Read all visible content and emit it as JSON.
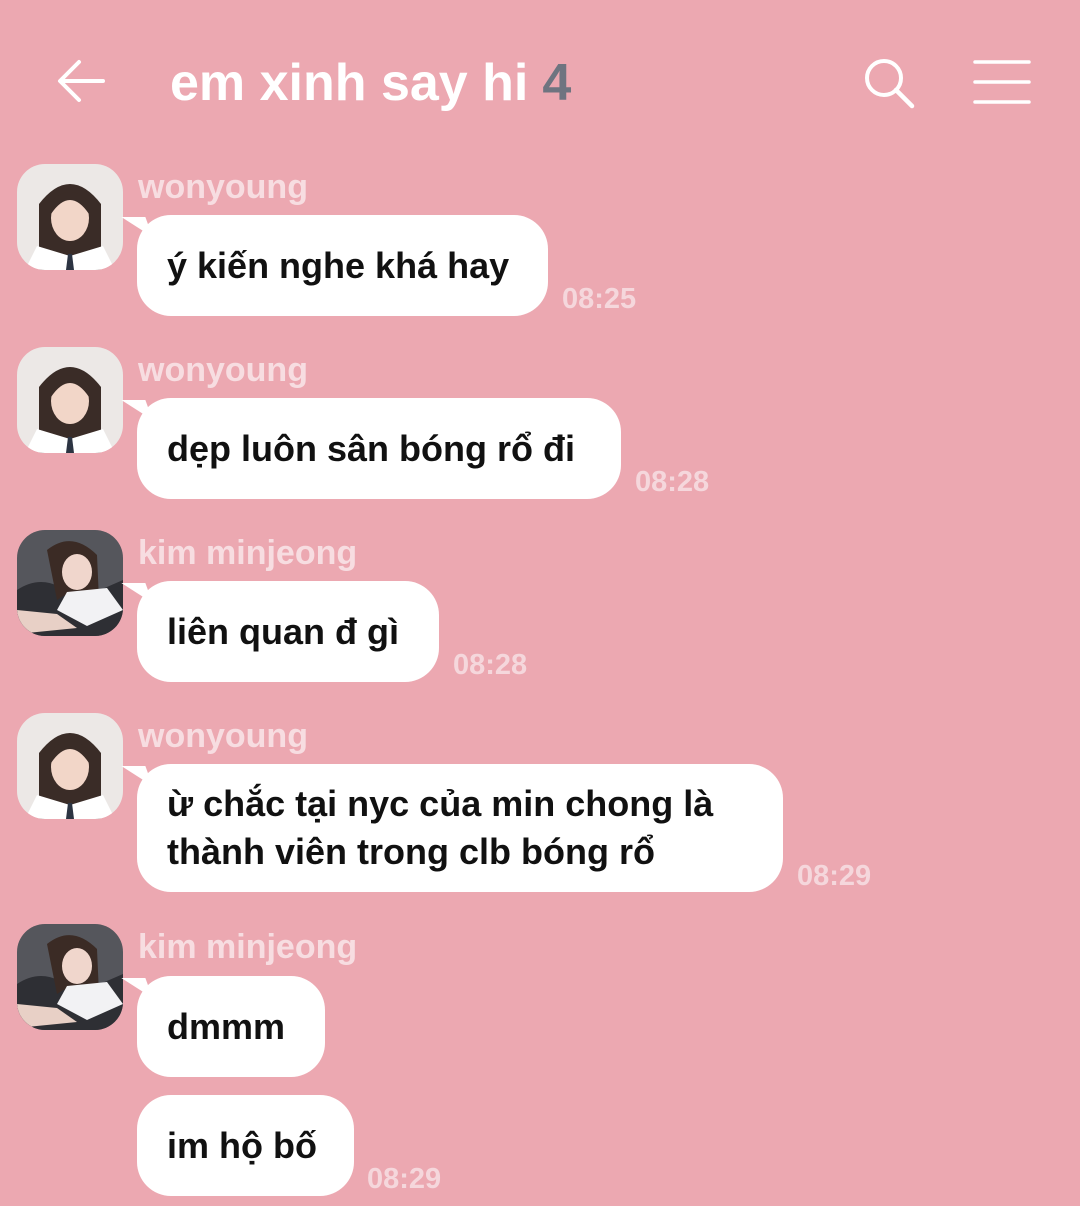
{
  "header": {
    "title": "em xinh say hi",
    "member_count": "4",
    "back_icon": "arrow-left-icon",
    "search_icon": "search-icon",
    "menu_icon": "hamburger-menu-icon"
  },
  "colors": {
    "background": "#eca8b1",
    "bubble": "#ffffff",
    "sender_name": "#f7dde1",
    "timestamp": "#f5d7dc",
    "member_count": "#6f7480"
  },
  "messages": [
    {
      "sender": "wonyoung",
      "text": "ý kiến nghe khá hay",
      "time": "08:25"
    },
    {
      "sender": "wonyoung",
      "text": "dẹp luôn sân bóng rổ đi",
      "time": "08:28"
    },
    {
      "sender": "kim minjeong",
      "text": "liên quan đ gì",
      "time": "08:28"
    },
    {
      "sender": "wonyoung",
      "lines": [
        "ừ chắc tại nyc của min chong là",
        "thành viên trong clb bóng rổ"
      ],
      "time": "08:29"
    },
    {
      "sender": "kim minjeong",
      "text": "dmmm"
    },
    {
      "text": "im hộ bố",
      "time": "08:29"
    }
  ]
}
